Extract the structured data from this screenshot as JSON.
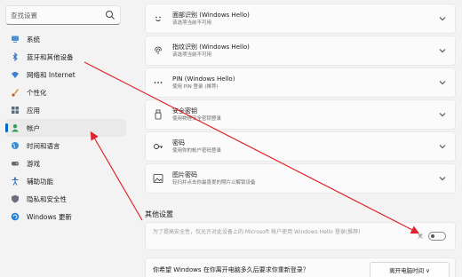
{
  "search": {
    "placeholder": "查找设置"
  },
  "sidebar": {
    "items": [
      {
        "label": "系统",
        "icon": "monitor-icon"
      },
      {
        "label": "蓝牙和其他设备",
        "icon": "bluetooth-icon"
      },
      {
        "label": "网络和 Internet",
        "icon": "wifi-icon"
      },
      {
        "label": "个性化",
        "icon": "paintbrush-icon"
      },
      {
        "label": "应用",
        "icon": "apps-icon"
      },
      {
        "label": "帐户",
        "icon": "person-icon",
        "active": true
      },
      {
        "label": "时间和语言",
        "icon": "globe-icon"
      },
      {
        "label": "游戏",
        "icon": "gamepad-icon"
      },
      {
        "label": "辅助功能",
        "icon": "accessibility-icon"
      },
      {
        "label": "隐私和安全性",
        "icon": "shield-icon"
      },
      {
        "label": "Windows 更新",
        "icon": "update-icon"
      }
    ]
  },
  "cards": [
    {
      "title": "面部识别 (Windows Hello)",
      "subtitle": "该选项当前不可用",
      "icon": "face-icon"
    },
    {
      "title": "指纹识别 (Windows Hello)",
      "subtitle": "该选项当前不可用",
      "icon": "fingerprint-icon"
    },
    {
      "title": "PIN (Windows Hello)",
      "subtitle": "使用 PIN 登录 (推荐)",
      "icon": "pin-icon"
    },
    {
      "title": "安全密钥",
      "subtitle": "使用物理安全密钥登录",
      "icon": "usb-key-icon"
    },
    {
      "title": "密码",
      "subtitle": "使用你的帐户密码登录",
      "icon": "key-icon"
    },
    {
      "title": "图片密码",
      "subtitle": "轻扫并点击你最喜爱的照片以解锁设备",
      "icon": "picture-icon"
    }
  ],
  "additional": {
    "section_title": "其他设置",
    "description": "为了提高安全性，仅允许对此设备上的 Microsoft 帐户使用 Windows Hello 登录(推荐)",
    "toggle_label": "关",
    "toggle_on": false
  },
  "bottom": {
    "text": "你希望 Windows 在你离开电脑多久后要求你重新登录？",
    "button_label": "离开电脑时间 ∨"
  },
  "colors": {
    "accent": "#0067c0",
    "annotation_arrow": "#e0262d"
  }
}
